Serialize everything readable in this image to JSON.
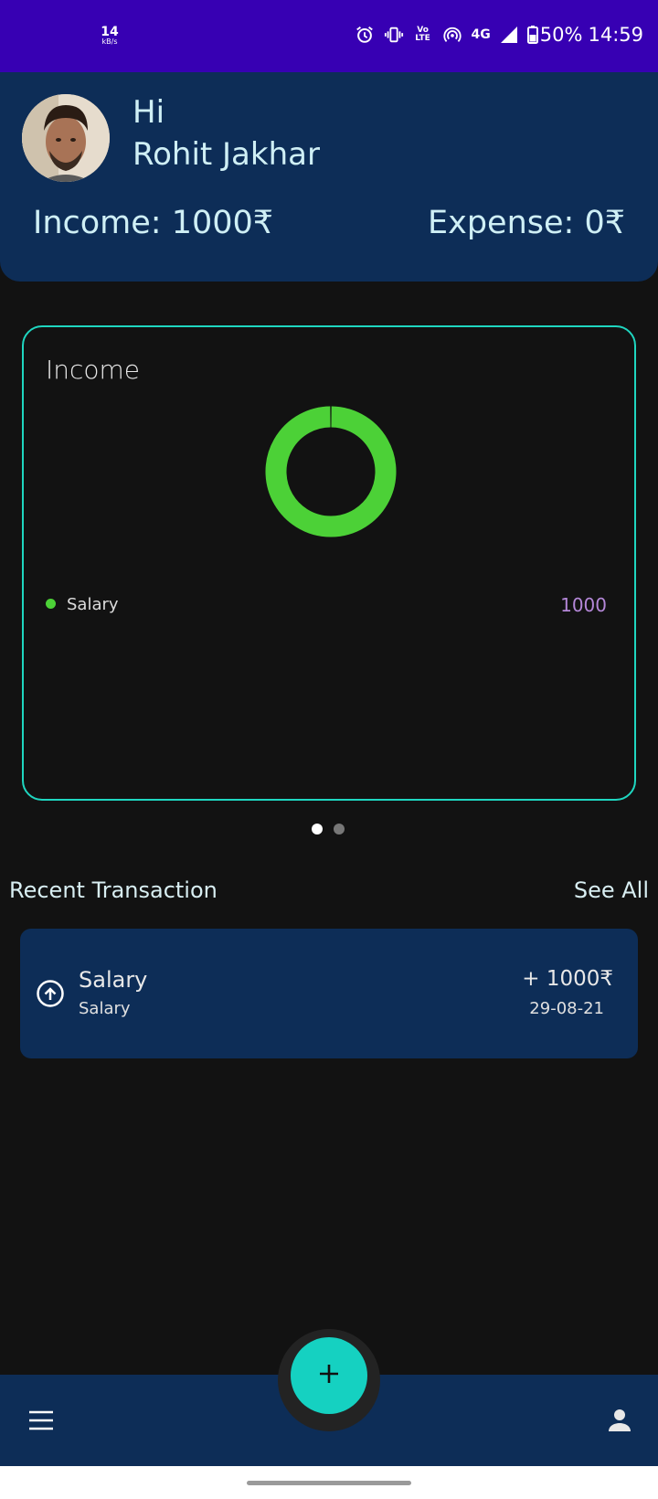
{
  "status_bar": {
    "net_speed": "14",
    "net_unit": "kB/s",
    "network": "4G",
    "volte": "Vo LTE",
    "battery": "50%",
    "time": "14:59"
  },
  "header": {
    "greeting": "Hi",
    "user_name": "Rohit Jakhar",
    "income": "Income: 1000₹",
    "expense": "Expense: 0₹"
  },
  "chart_data": {
    "type": "pie",
    "title": "Income",
    "categories": [
      "Salary"
    ],
    "values": [
      1000
    ],
    "colors": [
      "#4cd137"
    ],
    "legend": [
      {
        "label": "Salary",
        "value": "1000"
      }
    ]
  },
  "pager": {
    "pages": 2,
    "active": 0
  },
  "recent": {
    "title": "Recent Transaction",
    "see_all": "See All",
    "transactions": [
      {
        "title": "Salary",
        "category": "Salary",
        "amount": "+ 1000₹",
        "date": "29-08-21",
        "type": "income"
      }
    ]
  },
  "bottom_nav": {
    "left_icon": "menu-icon",
    "right_icon": "profile-icon",
    "fab_icon": "plus-icon"
  },
  "colors": {
    "status_bar": "#3700b3",
    "card_bg": "#0d2d57",
    "accent": "#15d1c1",
    "income": "#4cd137",
    "legend_value": "#b487d8",
    "background": "#121212"
  }
}
